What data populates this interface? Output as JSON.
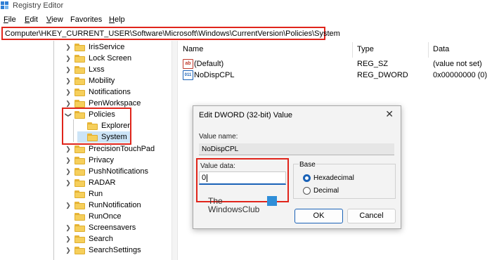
{
  "window": {
    "title": "Registry Editor"
  },
  "menu": [
    {
      "key": "F",
      "rest": "ile"
    },
    {
      "key": "E",
      "rest": "dit"
    },
    {
      "key": "V",
      "rest": "iew"
    },
    {
      "key": "",
      "rest": "Favorites"
    },
    {
      "key": "H",
      "rest": "elp"
    }
  ],
  "address": "Computer\\HKEY_CURRENT_USER\\Software\\Microsoft\\Windows\\CurrentVersion\\Policies\\System",
  "tree": [
    "IrisService",
    "Lock Screen",
    "Lxss",
    "Mobility",
    "Notifications",
    "PenWorkspace",
    "Policies",
    "Explorer",
    "System",
    "PrecisionTouchPad",
    "Privacy",
    "PushNotifications",
    "RADAR",
    "Run",
    "RunNotification",
    "RunOnce",
    "Screensavers",
    "Search",
    "SearchSettings"
  ],
  "columns": {
    "name": "Name",
    "type": "Type",
    "data": "Data"
  },
  "values": [
    {
      "name": "(Default)",
      "type": "REG_SZ",
      "data": "(value not set)",
      "icon": "ab-string-icon",
      "badge": "ab"
    },
    {
      "name": "NoDispCPL",
      "type": "REG_DWORD",
      "data": "0x00000000 (0)",
      "icon": "dword-icon",
      "badge": "011"
    }
  ],
  "dialog": {
    "title": "Edit DWORD (32-bit) Value",
    "close": "✕",
    "value_name_label": "Value name:",
    "value_name": "NoDispCPL",
    "value_data_label": "Value data:",
    "value_data": "0",
    "base_label": "Base",
    "hex_label": "Hexadecimal",
    "dec_label": "Decimal",
    "ok": "OK",
    "cancel": "Cancel"
  },
  "watermark": {
    "line1": "The",
    "line2": "WindowsClub"
  },
  "colors": {
    "highlight": "#e0251b",
    "accent": "#1a62b7",
    "selection": "#cce4f7"
  }
}
